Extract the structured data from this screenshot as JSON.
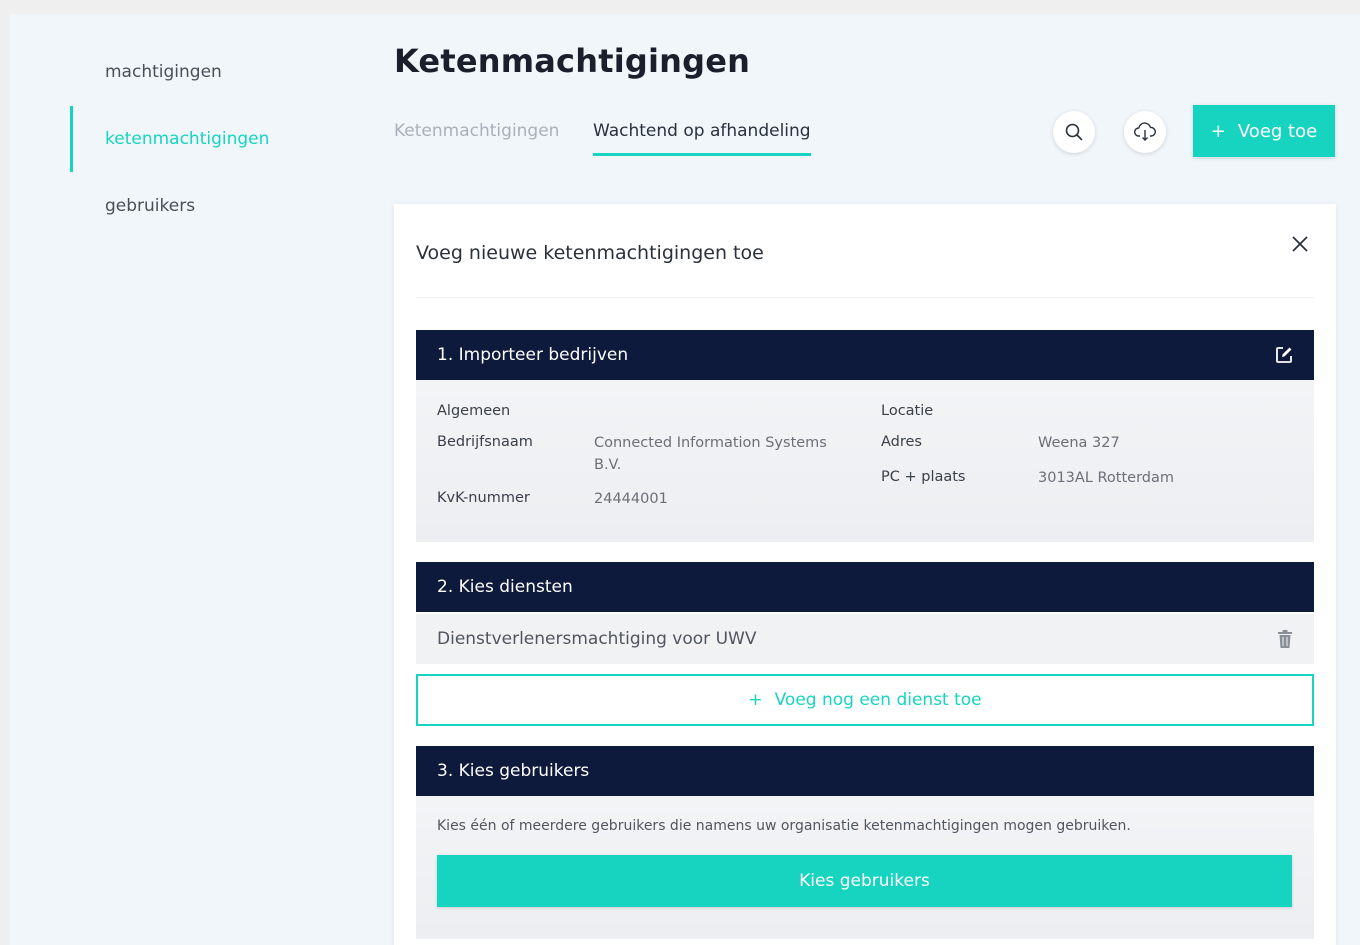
{
  "sidebar": {
    "items": [
      {
        "label": "machtigingen"
      },
      {
        "label": "ketenmachtigingen"
      },
      {
        "label": "gebruikers"
      }
    ]
  },
  "header": {
    "title": "Ketenmachtigingen",
    "tabs": [
      {
        "label": "Ketenmachtigingen"
      },
      {
        "label": "Wachtend op afhandeling"
      }
    ],
    "add_label": "Voeg toe"
  },
  "panel": {
    "title": "Voeg nieuwe ketenmachtigingen toe",
    "section1": {
      "header": "1. Importeer bedrijven",
      "general_heading": "Algemeen",
      "company_label": "Bedrijfsnaam",
      "company_value_line1": "Connected Information Systems",
      "company_value_line2": "B.V.",
      "kvk_label": "KvK-nummer",
      "kvk_value": "24444001",
      "location_heading": "Locatie",
      "address_label": "Adres",
      "address_value": "Weena 327",
      "postcode_label": "PC + plaats",
      "postcode_value": "3013AL Rotterdam"
    },
    "section2": {
      "header": "2. Kies diensten",
      "service": "Dienstverlenersmachtiging voor UWV",
      "add_service_label": "Voeg nog een dienst toe"
    },
    "section3": {
      "header": "3. Kies gebruikers",
      "description": "Kies één of meerdere gebruikers die namens uw organisatie ketenmachtigingen mogen gebruiken.",
      "button_label": "Kies gebruikers"
    }
  },
  "colors": {
    "accent": "#17d4c0",
    "navy": "#0e1a3c",
    "background": "#f1f6fb"
  }
}
